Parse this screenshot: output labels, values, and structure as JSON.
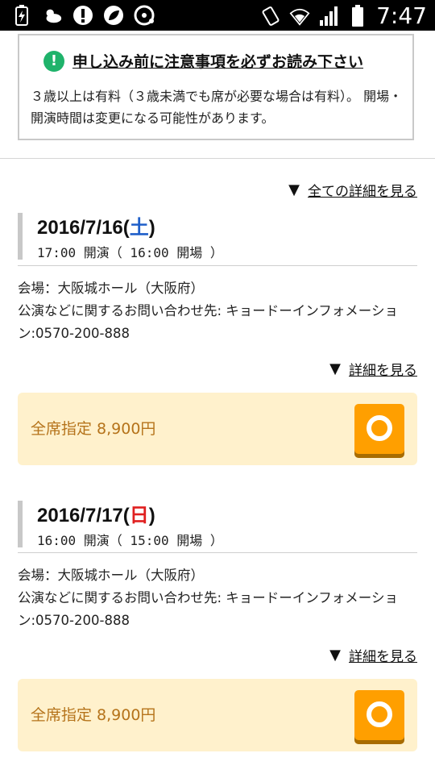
{
  "statusbar": {
    "time": "7:47"
  },
  "notice": {
    "title": "申し込み前に注意事項を必ずお読み下さい",
    "body": "３歳以上は有料（３歳未満でも席が必要な場合は有料）。 開場・開演時間は変更になる可能性があります。"
  },
  "all_details_link": "全ての詳細を見る",
  "performances": [
    {
      "date": "2016/7/16",
      "dow": "土",
      "time": "17:00 開演（ 16:00 開場 ）",
      "venue": "会場：大阪城ホール（大阪府）",
      "contact": "公演などに関するお問い合わせ先: キョードーインフォメーション:0570-200-888",
      "details_link": "詳細を見る",
      "seat_label": "全席指定 8,900円"
    },
    {
      "date": "2016/7/17",
      "dow": "日",
      "time": "16:00 開演（ 15:00 開場 ）",
      "venue": "会場：大阪城ホール（大阪府）",
      "contact": "公演などに関するお問い合わせ先: キョードーインフォメーション:0570-200-888",
      "details_link": "詳細を見る",
      "seat_label": "全席指定 8,900円"
    }
  ],
  "colors": {
    "saturday": "#1f5fc9",
    "sunday": "#e02020",
    "seat_bg": "#fff1cc",
    "seat_button": "#ff9f00"
  }
}
